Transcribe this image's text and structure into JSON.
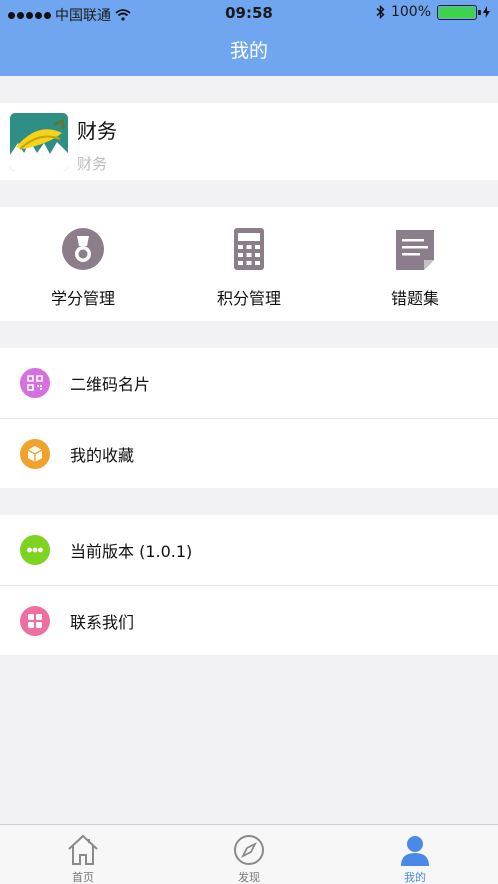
{
  "status_bar": {
    "carrier": "中国联通",
    "time": "09:58",
    "battery": "100%"
  },
  "nav": {
    "title": "我的"
  },
  "profile": {
    "name": "财务",
    "subtitle": "财务"
  },
  "grid": [
    {
      "label": "学分管理",
      "icon": "medal-icon"
    },
    {
      "label": "积分管理",
      "icon": "calculator-icon"
    },
    {
      "label": "错题集",
      "icon": "document-icon"
    }
  ],
  "list1": [
    {
      "label": "二维码名片",
      "icon": "qrcode-icon",
      "color": "#d66fe0"
    },
    {
      "label": "我的收藏",
      "icon": "box-icon",
      "color": "#f1a22a"
    }
  ],
  "list2": [
    {
      "label": "当前版本 (1.0.1)",
      "icon": "more-icon",
      "color": "#7ed321"
    },
    {
      "label": "联系我们",
      "icon": "apps-icon",
      "color": "#ee6fa0"
    }
  ],
  "tabs": [
    {
      "label": "首页",
      "icon": "home-icon"
    },
    {
      "label": "发现",
      "icon": "compass-icon"
    },
    {
      "label": "我的",
      "icon": "person-icon",
      "active": true
    }
  ],
  "colors": {
    "header": "#70a6f0",
    "accent": "#4a8ae6"
  }
}
